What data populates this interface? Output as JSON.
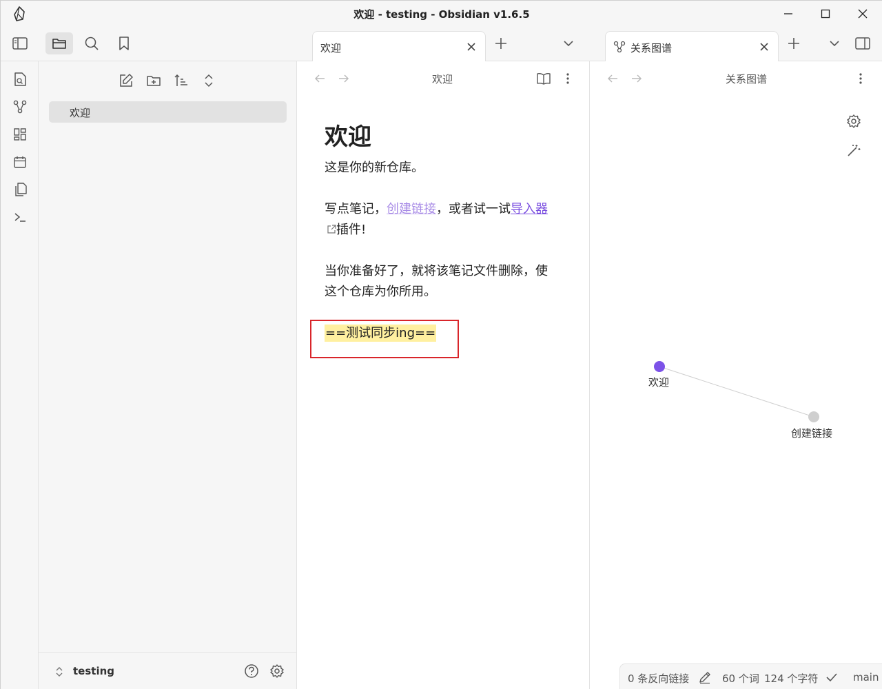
{
  "window": {
    "title": "欢迎 - testing - Obsidian v1.6.5"
  },
  "tabs": {
    "left": {
      "label": "欢迎"
    },
    "right": {
      "label": "关系图谱"
    }
  },
  "sidebar": {
    "files": [
      {
        "label": "欢迎"
      }
    ],
    "vault_name": "testing"
  },
  "editor": {
    "header_title": "欢迎",
    "heading": "欢迎",
    "para1": "这是你的新仓库。",
    "para2_prefix": "写点笔记，",
    "internal_link": "创建链接",
    "para2_mid": "，或者试一试",
    "external_link": "导入器",
    "para2_suffix": "插件!",
    "para3": "当你准备好了，就将该笔记文件删除，使这个仓库为你所用。",
    "highlight_text": "==测试同步ing=="
  },
  "graph": {
    "header_title": "关系图谱",
    "nodes": [
      {
        "label": "欢迎",
        "color": "#7c52e8",
        "active": true
      },
      {
        "label": "创建链接",
        "color": "#cfcfcf",
        "active": false
      }
    ]
  },
  "status_bar": {
    "backlinks": "0 条反向链接",
    "words": "60 个词",
    "chars": "124 个字符",
    "branch": "main"
  },
  "colors": {
    "accent": "#7c52e8",
    "highlight": "#fff0a0",
    "annotation_box": "#d9252a"
  }
}
